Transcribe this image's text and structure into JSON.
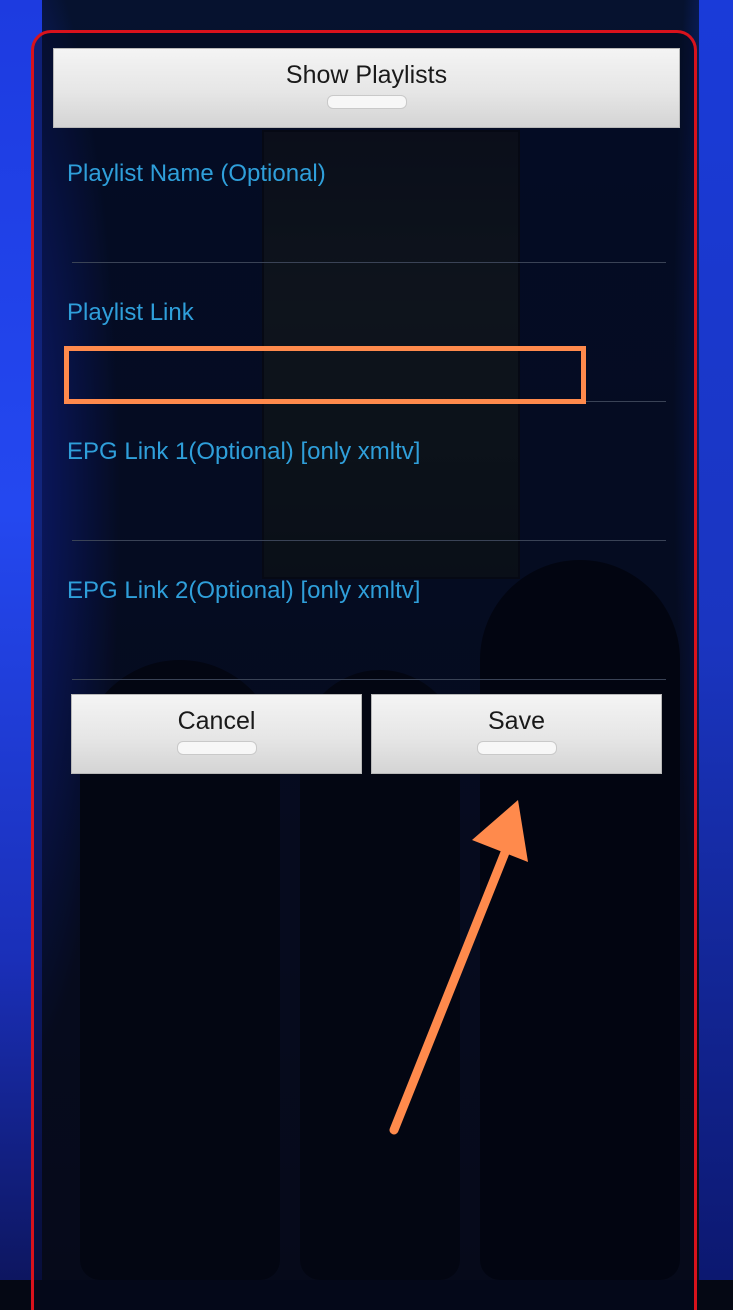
{
  "buttons": {
    "show_playlists": "Show Playlists",
    "cancel": "Cancel",
    "save": "Save"
  },
  "fields": {
    "playlist_name": {
      "label": "Playlist Name (Optional)",
      "value": ""
    },
    "playlist_link": {
      "label": "Playlist Link",
      "value": ""
    },
    "epg_link_1": {
      "label": "EPG Link 1(Optional) [only xmltv]",
      "value": ""
    },
    "epg_link_2": {
      "label": "EPG Link 2(Optional) [only xmltv]",
      "value": ""
    }
  },
  "colors": {
    "dialog_border": "#d8121c",
    "label_text": "#2f9fda",
    "annotation": "#ff8a4c"
  }
}
